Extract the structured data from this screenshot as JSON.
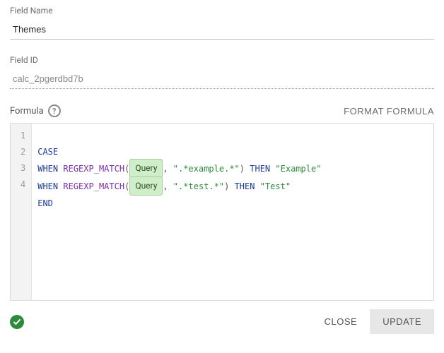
{
  "fieldName": {
    "label": "Field Name",
    "value": "Themes"
  },
  "fieldId": {
    "label": "Field ID",
    "value": "calc_2pgerdbd7b"
  },
  "formula": {
    "label": "Formula",
    "formatLabel": "FORMAT FORMULA",
    "tokens": {
      "case": "CASE",
      "when": "WHEN",
      "fn": "REGEXP_MATCH",
      "chip": "Query",
      "then": "THEN",
      "end": "END",
      "pat1": "\".*example.*\"",
      "res1": "\"Example\"",
      "pat2": "\".*test.*\"",
      "res2": "\"Test\""
    },
    "lineCount": 4
  },
  "footer": {
    "close": "CLOSE",
    "update": "UPDATE"
  }
}
